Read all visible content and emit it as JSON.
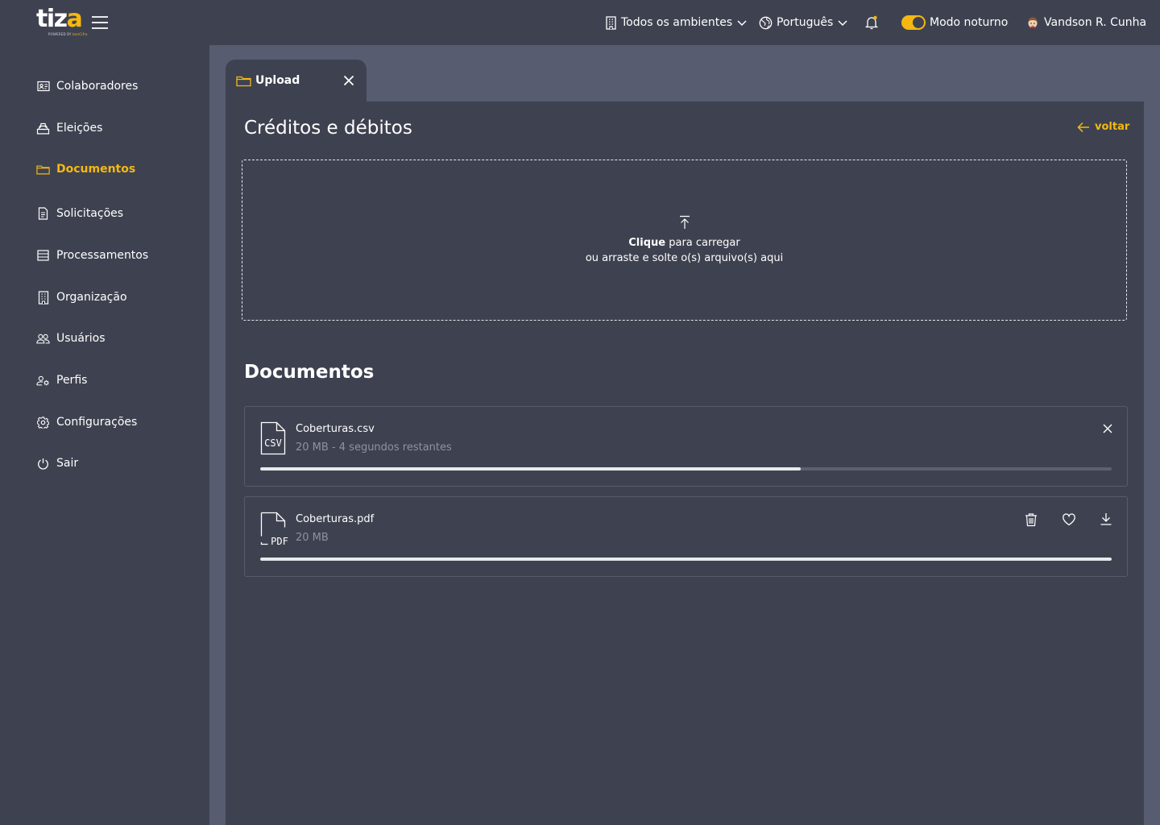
{
  "brand": {
    "logo_main": "tiz",
    "logo_accent": "a",
    "logo_sub": "POWERED BY",
    "logo_sub_brand": "benCifra"
  },
  "header": {
    "environment": "Todos os ambientes",
    "language": "Português",
    "night_mode_label": "Modo noturno",
    "night_mode_on": true,
    "user_name": "Vandson R. Cunha"
  },
  "sidebar": {
    "items": [
      {
        "label": "Colaboradores",
        "icon": "id-card-icon",
        "active": false
      },
      {
        "label": "Eleições",
        "icon": "ballot-box-icon",
        "active": false
      },
      {
        "label": "Documentos",
        "icon": "folder-icon",
        "active": true
      },
      {
        "label": "Solicitações",
        "icon": "document-icon",
        "active": false
      },
      {
        "label": "Processamentos",
        "icon": "list-icon",
        "active": false
      },
      {
        "label": "Organização",
        "icon": "building-icon",
        "active": false
      },
      {
        "label": "Usuários",
        "icon": "users-icon",
        "active": false
      },
      {
        "label": "Perfis",
        "icon": "user-gear-icon",
        "active": false
      },
      {
        "label": "Configurações",
        "icon": "gear-icon",
        "active": false
      },
      {
        "label": "Sair",
        "icon": "power-icon",
        "active": false
      }
    ]
  },
  "tab": {
    "label": "Upload"
  },
  "page": {
    "title": "Créditos e débitos",
    "back_label": "voltar"
  },
  "dropzone": {
    "click_bold": "Clique",
    "click_rest": " para carregar",
    "line2": "ou arraste e solte o(s) arquivo(s) aqui"
  },
  "documents": {
    "title": "Documentos",
    "files": [
      {
        "name": "Coberturas.csv",
        "type_label": "CSV",
        "meta": "20 MB - 4 segundos restantes",
        "progress": 0.635,
        "status": "uploading"
      },
      {
        "name": "Coberturas.pdf",
        "type_label": "PDF",
        "meta": "20 MB",
        "progress": 1.0,
        "status": "complete"
      }
    ]
  },
  "colors": {
    "accent": "#f5b811",
    "background": "#3e4250",
    "content_bg": "#575c70",
    "muted_text": "#8d92a3"
  }
}
